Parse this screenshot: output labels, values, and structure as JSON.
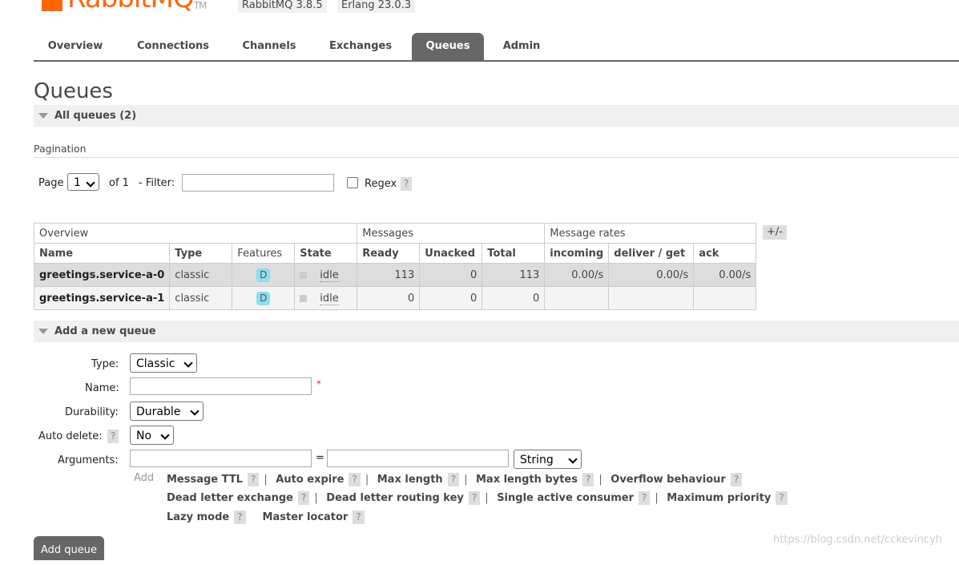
{
  "header": {
    "logo_text": "RabbitMQ",
    "logo_tm": "TM",
    "rabbitmq_version": "RabbitMQ 3.8.5",
    "erlang_version": "Erlang 23.0.3"
  },
  "tabs": [
    "Overview",
    "Connections",
    "Channels",
    "Exchanges",
    "Queues",
    "Admin"
  ],
  "page_title": "Queues",
  "all_queues": {
    "label": "All queues (2)"
  },
  "pagination": {
    "label": "Pagination",
    "page_label": "Page",
    "page_value": "1",
    "of_label": "of 1",
    "filter_label": "- Filter:",
    "regex_label": "Regex",
    "help": "?"
  },
  "table": {
    "groups": [
      "Overview",
      "Messages",
      "Message rates"
    ],
    "plus_minus": "+/-",
    "columns": [
      "Name",
      "Type",
      "Features",
      "State",
      "Ready",
      "Unacked",
      "Total",
      "incoming",
      "deliver / get",
      "ack"
    ],
    "rows": [
      {
        "name": "greetings.service-a-0",
        "type": "classic",
        "feature": "D",
        "state": "idle",
        "ready": "113",
        "unacked": "0",
        "total": "113",
        "incoming": "0.00/s",
        "deliver_get": "0.00/s",
        "ack": "0.00/s"
      },
      {
        "name": "greetings.service-a-1",
        "type": "classic",
        "feature": "D",
        "state": "idle",
        "ready": "0",
        "unacked": "0",
        "total": "0",
        "incoming": "",
        "deliver_get": "",
        "ack": ""
      }
    ]
  },
  "add_queue": {
    "section_label": "Add a new queue",
    "type_label": "Type:",
    "type_value": "Classic",
    "name_label": "Name:",
    "required_mark": "*",
    "durability_label": "Durability:",
    "durability_value": "Durable",
    "auto_delete_label": "Auto delete:",
    "auto_delete_value": "No",
    "arguments_label": "Arguments:",
    "equals": "=",
    "arg_type_value": "String",
    "add_label": "Add",
    "help": "?",
    "arg_links_row1": [
      "Message TTL",
      "Auto expire",
      "Max length",
      "Max length bytes",
      "Overflow behaviour"
    ],
    "arg_links_row2": [
      "Dead letter exchange",
      "Dead letter routing key",
      "Single active consumer",
      "Maximum priority"
    ],
    "arg_links_row3": [
      "Lazy mode",
      "Master locator"
    ],
    "submit_label": "Add queue"
  },
  "watermark": "https://blog.csdn.net/cckevincyh"
}
